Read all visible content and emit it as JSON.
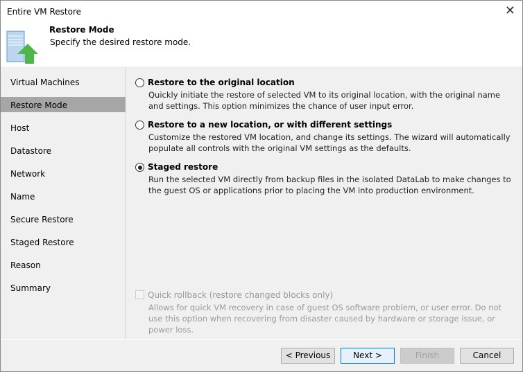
{
  "window": {
    "title": "Entire VM Restore"
  },
  "header": {
    "title": "Restore Mode",
    "subtitle": "Specify the desired restore mode."
  },
  "sidebar": {
    "items": [
      {
        "label": "Virtual Machines"
      },
      {
        "label": "Restore Mode"
      },
      {
        "label": "Host"
      },
      {
        "label": "Datastore"
      },
      {
        "label": "Network"
      },
      {
        "label": "Name"
      },
      {
        "label": "Secure Restore"
      },
      {
        "label": "Staged Restore"
      },
      {
        "label": "Reason"
      },
      {
        "label": "Summary"
      }
    ],
    "active": "Restore Mode"
  },
  "options": [
    {
      "label": "Restore to the original location",
      "desc": "Quickly initiate the restore of selected VM to its original location, with the original name and settings. This option minimizes the chance of user input error.",
      "selected": false
    },
    {
      "label": "Restore to a new location, or with different settings",
      "desc": "Customize the restored VM location, and change its settings. The wizard will automatically populate all controls with the original VM settings as the defaults.",
      "selected": false
    },
    {
      "label": "Staged restore",
      "desc": "Run the selected VM directly from backup files in the isolated DataLab to make changes to the guest OS or applications prior to placing the VM into production environment.",
      "selected": true
    }
  ],
  "quick_rollback": {
    "label": "Quick rollback (restore changed blocks only)",
    "desc": "Allows for quick VM recovery in case of guest OS software problem, or user error. Do not use this option when recovering from disaster caused by hardware or storage issue, or power loss.",
    "checked": false,
    "enabled": false
  },
  "buttons": {
    "previous": "< Previous",
    "next": "Next >",
    "finish": "Finish",
    "cancel": "Cancel"
  }
}
